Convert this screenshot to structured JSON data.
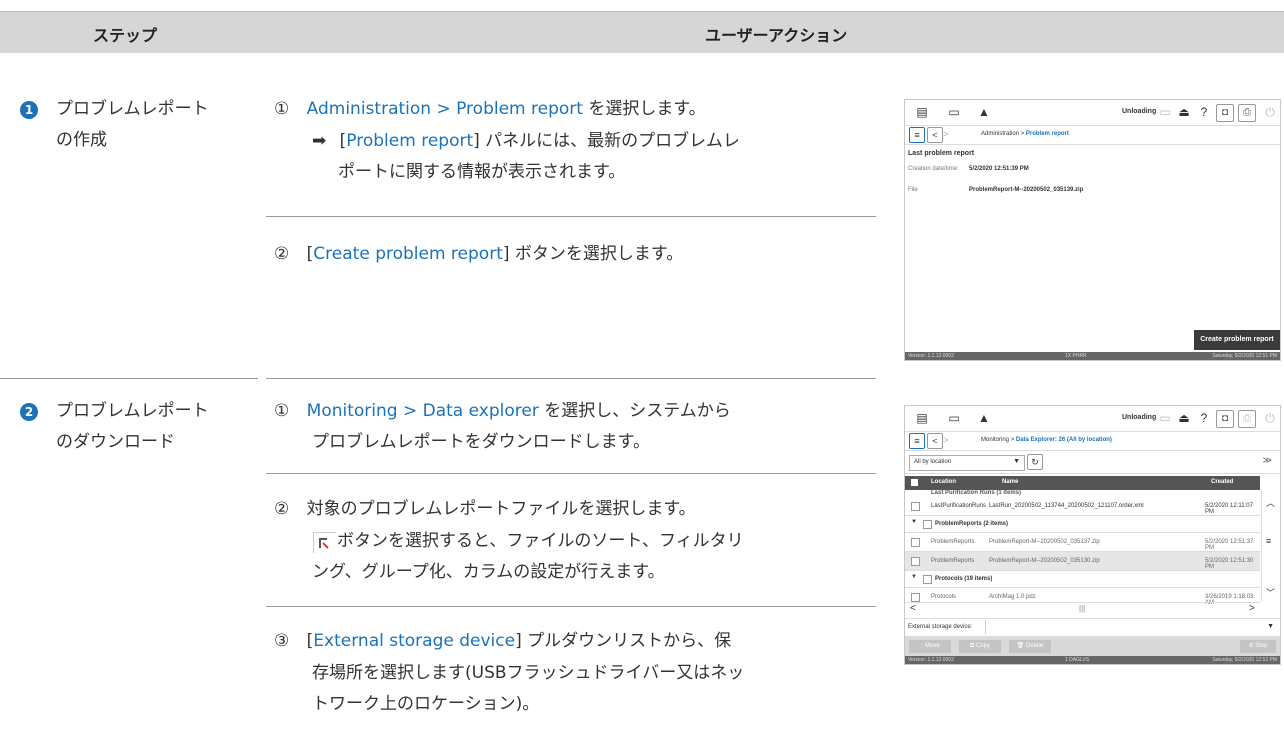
{
  "header": {
    "col1": "ステップ",
    "col2": "ユーザーアクション"
  },
  "step1": {
    "num": "1",
    "title_l1": "プロブレムレポート",
    "title_l2": "の作成",
    "a1_mark": "①",
    "a1_link": "Administration > Problem report",
    "a1_rest": "を選択します。",
    "a1_arrow": "➡",
    "a1_r1_pre": "[",
    "a1_r1_link": "Problem report",
    "a1_r1_post": "] パネルには、最新のプロブレムレ",
    "a1_r2": "ポートに関する情報が表示されます。",
    "a2_mark": "②",
    "a2_pre": "[",
    "a2_link": "Create problem report",
    "a2_post": "] ボタンを選択します。"
  },
  "step2": {
    "num": "2",
    "title_l1": "プロブレムレポート",
    "title_l2": "のダウンロード",
    "a1_mark": "①",
    "a1_link": "Monitoring > Data explorer",
    "a1_rest": "を選択し、システムから",
    "a1_l2": "プロブレムレポートをダウンロードします。",
    "a2_mark": "②",
    "a2_text": "対象のプロブレムレポートファイルを選択します。",
    "a2_note1": "ボタンを選択すると、ファイルのソート、フィルタリ",
    "a2_note2": "ング、グループ化、カラムの設定が行えます。",
    "a3_mark": "③",
    "a3_pre": "[",
    "a3_link": "External storage device",
    "a3_post": "] プルダウンリストから、保",
    "a3_l2": "存場所を選択します(USBフラッシュドライバー又はネッ",
    "a3_l3": "トワーク上のロケーション)。"
  },
  "shot1": {
    "unloading": "Unloading",
    "bc_parent": "Administration",
    "bc_sep": ">",
    "bc_current": "Problem report",
    "panel_title": "Last problem report",
    "created_label": "Creation date/time:",
    "created_value": "5/2/2020 12:51:39 PM",
    "file_label": "File",
    "file_value": "ProblemReport-M--20200502_035139.zip",
    "create_button": "Create problem report",
    "footer_version": "Version: 1.1.12.0002",
    "footer_center": "1X PHRR",
    "footer_date": "Saturday, 5/2/2020 12:51 PM"
  },
  "shot2": {
    "unloading": "Unloading",
    "bc_parent": "Monitoring",
    "bc_sep": ">",
    "bc_current": "Data Explorer: 26  (All by location)",
    "filter_value": "All by location",
    "col_location": "Location",
    "col_name": "Name",
    "col_created": "Created",
    "group_top": "Last Purification Runs (1 items)",
    "row1": {
      "location": "LastPurificationRuns",
      "name": "LastRun_20200502_113744_20200502_121107.order.xml",
      "created": "5/2/2020 12:11:07 PM"
    },
    "group_pr": "ProblemReports (2 items)",
    "row2": {
      "location": "ProblemReports",
      "name": "ProblemReport-M--20200502_035137.zip",
      "created": "5/2/2020 12:51:37 PM"
    },
    "row3": {
      "location": "ProblemReports",
      "name": "ProblemReport-M--20200502_035130.zip",
      "created": "5/2/2020 12:51:30 PM"
    },
    "group_prot": "Protocols (19 items)",
    "row4": {
      "location": "Protocols",
      "name": "ArchiMag 1.0.pdz",
      "created": "3/26/2019 1:18:03 AM"
    },
    "ext_label": "External storage device:",
    "btn_move": "Move",
    "btn_copy": "Copy",
    "btn_delete": "Delete",
    "btn_stop": "Stop",
    "footer_version": "Version: 1.1.12.0002",
    "footer_center": "1 DAGLVS",
    "footer_date": "Saturday, 5/2/2020 12:52 PM"
  }
}
